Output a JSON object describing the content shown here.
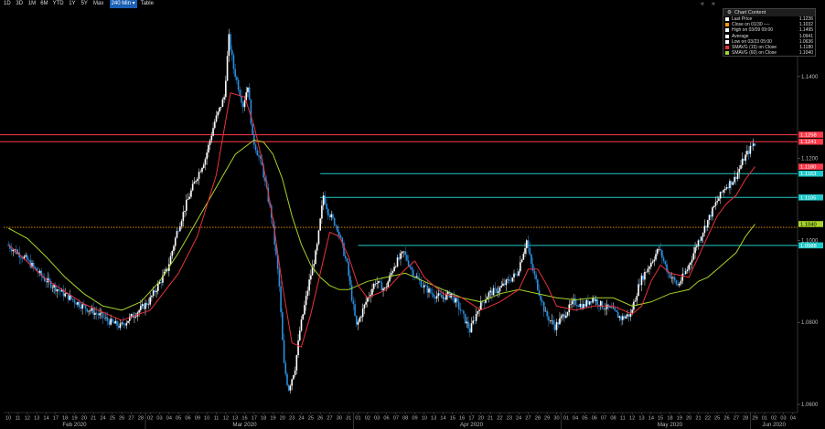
{
  "toolbar": {
    "timeframes": [
      "1D",
      "3D",
      "1M",
      "6M",
      "YTD",
      "1Y",
      "5Y",
      "Max"
    ],
    "active": "240 Min",
    "table_label": "Table",
    "content_label": "Chart Content"
  },
  "legend": [
    {
      "name": "Last Price",
      "value": "1.1236",
      "color": "#ffffff"
    },
    {
      "name": "Close on 01/30 ----",
      "value": "1.1032",
      "color": "#ff9900"
    },
    {
      "name": "High on 03/09 09:00",
      "value": "1.1495",
      "color": "#ffffff"
    },
    {
      "name": "Average",
      "value": "1.0941",
      "color": "#ffffff"
    },
    {
      "name": "Low on 03/23 05:00",
      "value": "1.0636",
      "color": "#ffffff"
    },
    {
      "name": "SMAVG (15)  on Close",
      "value": "1.1180",
      "color": "#e8323c"
    },
    {
      "name": "SMAVG (60)  on Close",
      "value": "1.1040",
      "color": "#a6d32a"
    }
  ],
  "colors": {
    "up": "#ffffff",
    "down": "#2b8fe0",
    "sma15": "#e8323c",
    "sma60": "#a6d32a",
    "red_level": "#ff3a4a",
    "cyan_level": "#1fc9c9",
    "close_line": "#ff9900"
  },
  "chart_data": {
    "type": "line",
    "title": "",
    "ylim": [
      1.058,
      1.156
    ],
    "yticks": [
      1.06,
      1.08,
      1.1,
      1.12,
      1.14
    ],
    "ytick_labels": [
      "1.0600",
      "1.0800",
      "1.1000",
      "1.1200",
      "1.1400"
    ],
    "x_day_labels": [
      "10",
      "11",
      "12",
      "13",
      "14",
      "17",
      "18",
      "19",
      "20",
      "21",
      "24",
      "25",
      "26",
      "27",
      "28",
      "02",
      "03",
      "04",
      "05",
      "06",
      "09",
      "10",
      "11",
      "12",
      "13",
      "16",
      "17",
      "18",
      "19",
      "20",
      "23",
      "24",
      "25",
      "26",
      "27",
      "30",
      "31",
      "01",
      "02",
      "03",
      "06",
      "07",
      "08",
      "09",
      "10",
      "13",
      "14",
      "15",
      "16",
      "17",
      "20",
      "21",
      "22",
      "23",
      "24",
      "27",
      "28",
      "29",
      "30",
      "01",
      "04",
      "05",
      "06",
      "07",
      "08",
      "11",
      "12",
      "13",
      "14",
      "15",
      "18",
      "19",
      "20",
      "21",
      "22",
      "25",
      "26",
      "27",
      "28",
      "29",
      "01",
      "02",
      "03",
      "04"
    ],
    "month_labels": [
      {
        "label": "Feb 2020",
        "index": 7
      },
      {
        "label": "Mar 2020",
        "index": 25
      },
      {
        "label": "Apr 2020",
        "index": 49
      },
      {
        "label": "May 2020",
        "index": 70
      },
      {
        "label": "Jun 2020",
        "index": 81
      }
    ],
    "price_path": [
      [
        0,
        1.099
      ],
      [
        2,
        1.0955
      ],
      [
        4,
        1.0905
      ],
      [
        6,
        1.087
      ],
      [
        8,
        1.084
      ],
      [
        10,
        1.0815
      ],
      [
        11,
        1.08
      ],
      [
        12,
        1.079
      ],
      [
        13,
        1.081
      ],
      [
        15,
        1.085
      ],
      [
        17,
        1.093
      ],
      [
        18,
        1.102
      ],
      [
        19,
        1.109
      ],
      [
        20,
        1.115
      ],
      [
        21,
        1.12
      ],
      [
        22,
        1.129
      ],
      [
        23,
        1.135
      ],
      [
        23.5,
        1.1495
      ],
      [
        24,
        1.142
      ],
      [
        25,
        1.133
      ],
      [
        25.5,
        1.138
      ],
      [
        26,
        1.125
      ],
      [
        27,
        1.118
      ],
      [
        28,
        1.106
      ],
      [
        28.8,
        1.09
      ],
      [
        29.3,
        1.07
      ],
      [
        29.8,
        1.0636
      ],
      [
        30.5,
        1.069
      ],
      [
        31,
        1.078
      ],
      [
        32,
        1.09
      ],
      [
        32.8,
        1.098
      ],
      [
        33.5,
        1.111
      ],
      [
        34,
        1.107
      ],
      [
        35,
        1.103
      ],
      [
        36,
        1.094
      ],
      [
        36.5,
        1.086
      ],
      [
        37,
        1.079
      ],
      [
        38,
        1.085
      ],
      [
        39,
        1.09
      ],
      [
        40,
        1.088
      ],
      [
        41,
        1.094
      ],
      [
        42,
        1.097
      ],
      [
        43,
        1.092
      ],
      [
        44,
        1.089
      ],
      [
        45,
        1.087
      ],
      [
        46,
        1.086
      ],
      [
        47,
        1.087
      ],
      [
        48,
        1.083
      ],
      [
        49,
        1.078
      ],
      [
        50,
        1.084
      ],
      [
        51,
        1.087
      ],
      [
        52,
        1.088
      ],
      [
        53,
        1.09
      ],
      [
        54,
        1.092
      ],
      [
        55,
        1.1
      ],
      [
        55.5,
        1.094
      ],
      [
        56,
        1.09
      ],
      [
        57,
        1.082
      ],
      [
        58,
        1.079
      ],
      [
        59,
        1.082
      ],
      [
        60,
        1.085
      ],
      [
        61,
        1.084
      ],
      [
        62,
        1.086
      ],
      [
        63,
        1.084
      ],
      [
        64,
        1.083
      ],
      [
        65,
        1.081
      ],
      [
        66,
        1.082
      ],
      [
        67,
        1.09
      ],
      [
        68,
        1.094
      ],
      [
        69,
        1.098
      ],
      [
        70,
        1.092
      ],
      [
        71,
        1.089
      ],
      [
        72,
        1.093
      ],
      [
        73,
        1.099
      ],
      [
        74,
        1.104
      ],
      [
        75,
        1.109
      ],
      [
        76,
        1.113
      ],
      [
        77,
        1.115
      ],
      [
        78,
        1.12
      ],
      [
        79,
        1.1236
      ]
    ],
    "sma15_path": [
      [
        0,
        1.099
      ],
      [
        4,
        1.0905
      ],
      [
        8,
        1.0845
      ],
      [
        12,
        1.0805
      ],
      [
        15,
        1.083
      ],
      [
        18,
        1.092
      ],
      [
        20,
        1.101
      ],
      [
        22,
        1.116
      ],
      [
        23.5,
        1.136
      ],
      [
        25,
        1.135
      ],
      [
        26,
        1.128
      ],
      [
        27,
        1.118
      ],
      [
        28,
        1.105
      ],
      [
        29,
        1.089
      ],
      [
        30,
        1.075
      ],
      [
        31,
        1.074
      ],
      [
        32,
        1.082
      ],
      [
        33,
        1.092
      ],
      [
        34,
        1.102
      ],
      [
        35,
        1.101
      ],
      [
        36,
        1.096
      ],
      [
        37,
        1.089
      ],
      [
        38,
        1.086
      ],
      [
        40,
        1.088
      ],
      [
        42,
        1.093
      ],
      [
        43,
        1.095
      ],
      [
        44,
        1.091
      ],
      [
        46,
        1.087
      ],
      [
        48,
        1.086
      ],
      [
        50,
        1.083
      ],
      [
        52,
        1.085
      ],
      [
        54,
        1.088
      ],
      [
        55,
        1.093
      ],
      [
        56,
        1.093
      ],
      [
        57,
        1.089
      ],
      [
        58,
        1.084
      ],
      [
        60,
        1.083
      ],
      [
        62,
        1.084
      ],
      [
        64,
        1.084
      ],
      [
        66,
        1.082
      ],
      [
        67,
        1.084
      ],
      [
        68,
        1.09
      ],
      [
        69,
        1.094
      ],
      [
        70,
        1.092
      ],
      [
        72,
        1.091
      ],
      [
        73,
        1.096
      ],
      [
        74,
        1.101
      ],
      [
        75,
        1.106
      ],
      [
        76,
        1.109
      ],
      [
        77,
        1.111
      ],
      [
        78,
        1.115
      ],
      [
        79,
        1.118
      ]
    ],
    "sma60_path": [
      [
        0,
        1.103
      ],
      [
        2,
        1.1005
      ],
      [
        4,
        1.096
      ],
      [
        6,
        1.091
      ],
      [
        8,
        1.087
      ],
      [
        10,
        1.084
      ],
      [
        12,
        1.083
      ],
      [
        14,
        1.085
      ],
      [
        16,
        1.09
      ],
      [
        18,
        1.097
      ],
      [
        20,
        1.105
      ],
      [
        22,
        1.113
      ],
      [
        24,
        1.121
      ],
      [
        26,
        1.1245
      ],
      [
        27,
        1.124
      ],
      [
        28,
        1.121
      ],
      [
        29,
        1.115
      ],
      [
        30,
        1.106
      ],
      [
        31,
        1.099
      ],
      [
        32,
        1.094
      ],
      [
        33,
        1.091
      ],
      [
        34,
        1.089
      ],
      [
        35,
        1.088
      ],
      [
        36,
        1.088
      ],
      [
        38,
        1.09
      ],
      [
        40,
        1.091
      ],
      [
        42,
        1.092
      ],
      [
        44,
        1.09
      ],
      [
        46,
        1.088
      ],
      [
        48,
        1.086
      ],
      [
        50,
        1.085
      ],
      [
        52,
        1.087
      ],
      [
        54,
        1.088
      ],
      [
        56,
        1.087
      ],
      [
        58,
        1.086
      ],
      [
        60,
        1.0855
      ],
      [
        62,
        1.086
      ],
      [
        64,
        1.086
      ],
      [
        66,
        1.084
      ],
      [
        68,
        1.085
      ],
      [
        70,
        1.087
      ],
      [
        72,
        1.088
      ],
      [
        73,
        1.09
      ],
      [
        74,
        1.091
      ],
      [
        75,
        1.093
      ],
      [
        76,
        1.095
      ],
      [
        77,
        1.097
      ],
      [
        78,
        1.101
      ],
      [
        79,
        1.104
      ]
    ],
    "levels": [
      {
        "value": 1.1258,
        "label": "1.1258",
        "color": "#ff3a4a",
        "x_start": 0
      },
      {
        "value": 1.1241,
        "label": "1.1241",
        "color": "#ff3a4a",
        "x_start": 0
      },
      {
        "value": 1.118,
        "label": "1.1180",
        "color": "#ff3a4a",
        "x_start": 79
      },
      {
        "value": 1.1163,
        "label": "1.1163",
        "color": "#1fc9c9",
        "x_start": 33
      },
      {
        "value": 1.1105,
        "label": "1.1105",
        "color": "#1fc9c9",
        "x_start": 33
      },
      {
        "value": 1.104,
        "label": "1.1040",
        "color": "#a6d32a",
        "x_start": 79
      },
      {
        "value": 1.0988,
        "label": "1.0988",
        "color": "#1fc9c9",
        "x_start": 37
      }
    ],
    "close_level": 1.1032
  }
}
